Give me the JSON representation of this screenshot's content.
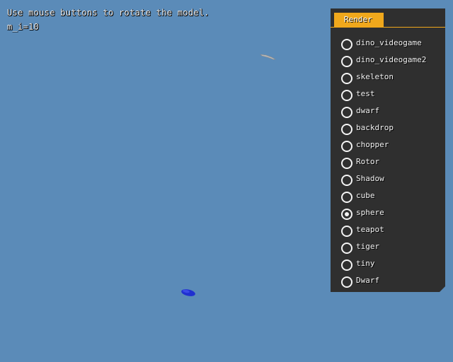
{
  "info": {
    "instructions": "Use mouse buttons to rotate the model.",
    "status": "m_i=10"
  },
  "render_panel": {
    "tab_label": "Render",
    "selected": "sphere",
    "items": [
      {
        "label": "dino_videogame"
      },
      {
        "label": "dino_videogame2"
      },
      {
        "label": "skeleton"
      },
      {
        "label": "test"
      },
      {
        "label": "dwarf"
      },
      {
        "label": "backdrop"
      },
      {
        "label": "chopper"
      },
      {
        "label": "Rotor"
      },
      {
        "label": "Shadow"
      },
      {
        "label": "cube"
      },
      {
        "label": "sphere"
      },
      {
        "label": "teapot"
      },
      {
        "label": "tiger"
      },
      {
        "label": "tiny"
      },
      {
        "label": "Dwarf"
      }
    ]
  },
  "colors": {
    "background": "#5b8bb8",
    "panel": "#2f2f2f",
    "accent": "#f0a81c",
    "model_blue": "#2030d0",
    "model_grey": "#b8b8b8"
  }
}
